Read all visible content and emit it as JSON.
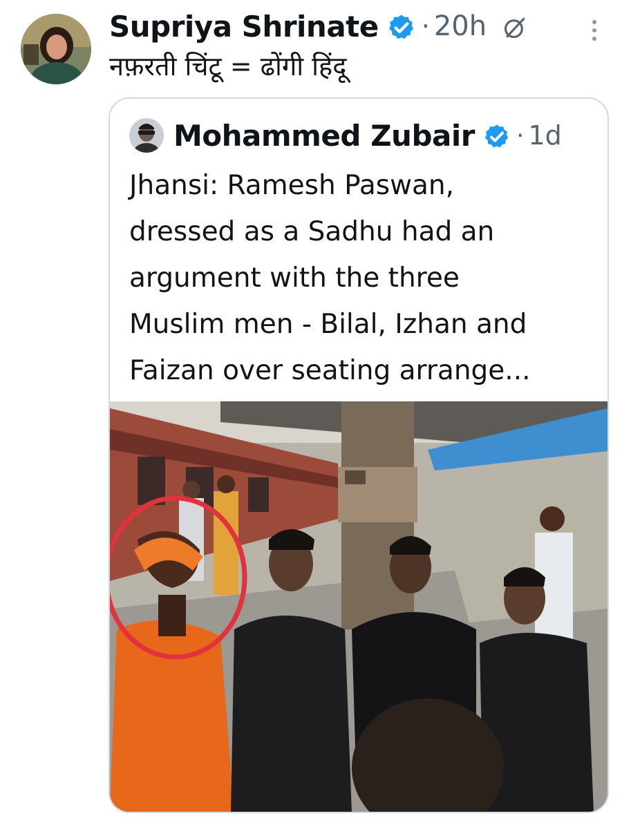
{
  "tweet": {
    "author_name": "Supriya Shrinate",
    "separator": "·",
    "time": "20h",
    "text": "नफ़रती चिंटू = ढोंगी हिंदू"
  },
  "quoted_tweet": {
    "author_name": "Mohammed Zubair",
    "separator": "·",
    "time": "1d",
    "text": "Jhansi: Ramesh Paswan,\ndressed as a Sadhu had an\nargument with the three\nMuslim men - Bilal, Izhan and\nFaizan over seating arrange..."
  },
  "icons": {
    "verified": "verified-badge-icon",
    "grok": "grok-icon",
    "more": "more-options-icon"
  },
  "colors": {
    "verified_blue": "#1d9bf0",
    "text_primary": "#0f1419",
    "text_secondary": "#536471",
    "card_border": "#cfd9de",
    "highlight_circle": "#e0333b"
  }
}
